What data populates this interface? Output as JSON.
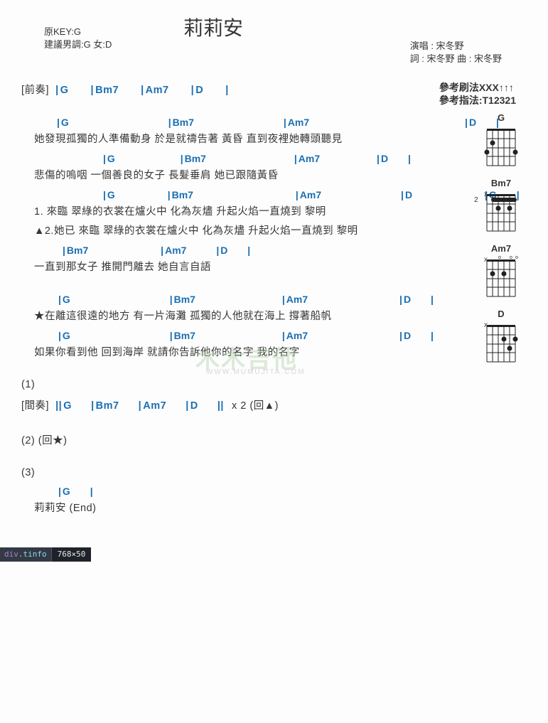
{
  "title": "莉莉安",
  "key_label": "原KEY:G",
  "suggest_key_label": "建議男調:G 女:D",
  "credits": {
    "performer_label": "演唱 : 宋冬野",
    "lyricist_label": "詞 : 宋冬野   曲 : 宋冬野"
  },
  "reference": {
    "strum_label": "參考刷法XXX↑↑↑",
    "finger_label": "參考指法:T12321"
  },
  "intro": {
    "section_label": "[前奏]",
    "chord_bars": [
      "G",
      "Bm7",
      "Am7",
      "D"
    ]
  },
  "verse1": [
    {
      "chords": {
        "items": [
          "G",
          "Bm7",
          "Am7",
          "D"
        ],
        "gaps": [
          50,
          155,
          155,
          310
        ]
      },
      "lyric": "她發現孤獨的人準備動身    於是就禱告著    黃昏    直到夜裡她轉頭聽見",
      "lyric_indent": 18
    },
    {
      "chords": {
        "items": [
          "G",
          "Bm7",
          "Am7",
          "D"
        ],
        "gaps": [
          115,
          105,
          150,
          105
        ]
      },
      "lyric": "悲傷的嗚咽    一個善良的女子    長髮垂肩    她已跟隨黃昏",
      "lyric_indent": 18
    }
  ],
  "chorus1": [
    {
      "chords": {
        "items": [
          "G",
          "Bm7",
          "Am7",
          "D",
          "G"
        ],
        "gaps": [
          115,
          85,
          170,
          140,
          115
        ]
      },
      "lyric1": {
        "prefix": "1.        ",
        "body": "來臨    翠綠的衣裳在爐火中    化為灰燼    升起火焰一直燒到    黎明",
        "indent": 18
      },
      "lyric2": {
        "prefix": "▲2.她已 ",
        "body": "來臨    翠綠的衣裳在爐火中    化為灰燼    升起火焰一直燒到    黎明",
        "indent": 18
      }
    },
    {
      "chords": {
        "items": [
          "Bm7",
          "Am7",
          "D"
        ],
        "gaps": [
          58,
          120,
          62
        ]
      },
      "lyric": "一直到那女子    推開門離去    她自言自語",
      "lyric_indent": 18
    }
  ],
  "bridge": [
    {
      "chords": {
        "items": [
          "G",
          "Bm7",
          "Am7",
          "D"
        ],
        "gaps": [
          52,
          150,
          150,
          150
        ]
      },
      "lyric": "★在離這很遠的地方    有一片海灘    孤獨的人他就在海上    撐著船帆",
      "lyric_indent": 18
    },
    {
      "chords": {
        "items": [
          "G",
          "Bm7",
          "Am7",
          "D"
        ],
        "gaps": [
          52,
          150,
          150,
          150
        ]
      },
      "lyric": "如果你看到他    回到海岸    就請你告訴他你的名字    我的名字",
      "lyric_indent": 18
    }
  ],
  "markers": {
    "m1": "(1)",
    "interlude_label": "[間奏]",
    "interlude_chords": [
      "G",
      "Bm7",
      "Am7",
      "D"
    ],
    "interlude_suffix": "x 2  (回▲)",
    "m2": "(2)  (回★)",
    "m3": "(3)",
    "ending_chord": "G",
    "ending_lyric": "莉莉安           (End)"
  },
  "chord_shapes": {
    "G": {
      "label": "G",
      "marker": ""
    },
    "Bm7": {
      "label": "Bm7",
      "marker": "x",
      "fret": "2"
    },
    "Am7": {
      "label": "Am7",
      "marker": "x"
    },
    "D": {
      "label": "D",
      "marker": "x"
    }
  },
  "devtools": {
    "tag": "div",
    "class": ".tinfo",
    "size": "768×50"
  },
  "watermark": {
    "main": "木木吉他",
    "sub": "WWW.MUMUJITA.COM"
  }
}
